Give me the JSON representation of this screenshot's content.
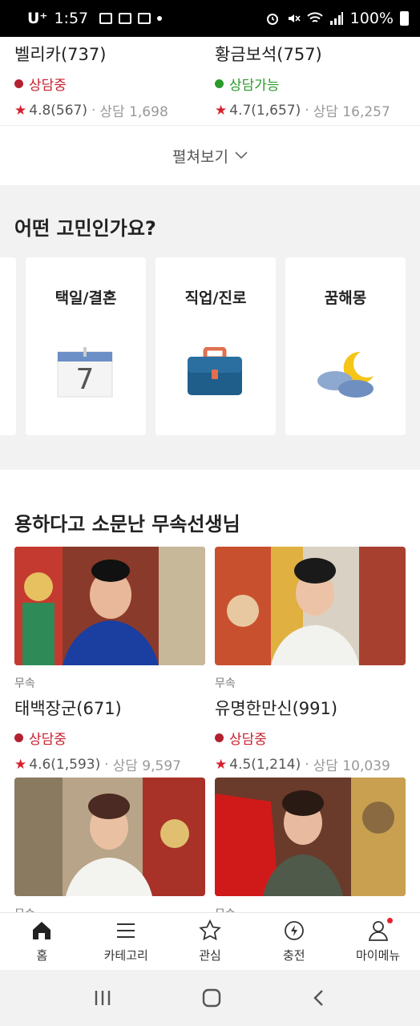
{
  "status_bar": {
    "carrier": "U⁺",
    "time": "1:57",
    "battery": "100%"
  },
  "top_consultants": [
    {
      "name": "벨리카(737)",
      "status": "상담중",
      "status_type": "busy",
      "rating": "4.8(567)",
      "consult_count": "상담 1,698"
    },
    {
      "name": "황금보석(757)",
      "status": "상담가능",
      "status_type": "available",
      "rating": "4.7(1,657)",
      "consult_count": "상담 16,257"
    }
  ],
  "expand_label": "펼쳐보기",
  "concern_section": {
    "title": "어떤 고민인가요?",
    "calendar_number": "7",
    "cards": [
      {
        "label": "택일/결혼",
        "icon": "calendar-icon"
      },
      {
        "label": "직업/진로",
        "icon": "briefcase-icon"
      },
      {
        "label": "꿈해몽",
        "icon": "moon-cloud-icon"
      }
    ]
  },
  "shaman_section": {
    "title": "용하다고 소문난 무속선생님",
    "teachers": [
      {
        "category": "무속",
        "name": "태백장군(671)",
        "status": "상담중",
        "status_type": "busy",
        "rating": "4.6(1,593)",
        "consult_count": "상담 9,597"
      },
      {
        "category": "무속",
        "name": "유명한만신(991)",
        "status": "상담중",
        "status_type": "busy",
        "rating": "4.5(1,214)",
        "consult_count": "상담 10,039"
      },
      {
        "category": "무속"
      },
      {
        "category": "무속"
      }
    ]
  },
  "tabbar": [
    {
      "label": "홈",
      "icon": "home-icon"
    },
    {
      "label": "카테고리",
      "icon": "menu-icon"
    },
    {
      "label": "관심",
      "icon": "star-icon"
    },
    {
      "label": "충전",
      "icon": "charge-icon"
    },
    {
      "label": "마이메뉴",
      "icon": "person-icon"
    }
  ],
  "colors": {
    "busy": "#c8202e",
    "available": "#2a9a2a",
    "star": "#d6202e"
  }
}
